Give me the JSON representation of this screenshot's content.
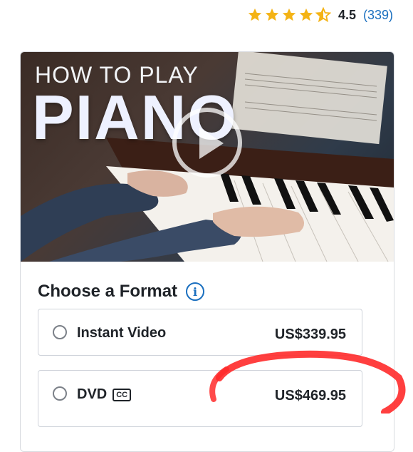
{
  "rating": {
    "value": "4.5",
    "count": "(339)",
    "stars_filled": 4.5,
    "star_color": "#f4b315"
  },
  "hero": {
    "title_small": "HOW TO PLAY",
    "title_big": "PIANO",
    "play_icon": "play-icon"
  },
  "format_section": {
    "title": "Choose a Format",
    "info_icon": "info-icon",
    "options": [
      {
        "label": "Instant Video",
        "price": "US$339.95",
        "selected": false
      },
      {
        "label": "DVD",
        "badge": "CC",
        "price": "US$469.95",
        "selected": false
      }
    ]
  },
  "colors": {
    "link": "#1a6fbf",
    "annotation_red": "#ff2a2a",
    "border": "#cfd3da"
  }
}
